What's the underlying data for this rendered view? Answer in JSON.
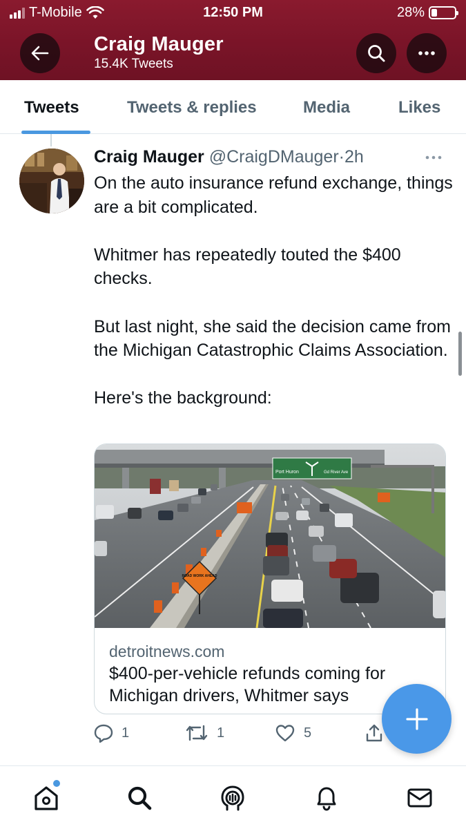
{
  "status_bar": {
    "carrier": "T-Mobile",
    "time": "12:50 PM",
    "battery": "28%"
  },
  "header": {
    "title": "Craig Mauger",
    "subtitle": "15.4K Tweets"
  },
  "tabs": [
    {
      "label": "Tweets",
      "active": true
    },
    {
      "label": "Tweets & replies",
      "active": false
    },
    {
      "label": "Media",
      "active": false
    },
    {
      "label": "Likes",
      "active": false
    }
  ],
  "tweet": {
    "author_name": "Craig Mauger",
    "handle": "@CraigDMauger",
    "separator": "·",
    "time": "2h",
    "paragraphs": [
      "On the auto insurance refund exchange, things are a bit complicated.",
      "Whitmer has repeatedly touted the $400 checks.",
      "But last night, she said the decision came from the Michigan Catastrophic Claims Association.",
      "Here's the background:"
    ],
    "card": {
      "domain": "detroitnews.com",
      "title": "$400-per-vehicle refunds coming for Michigan drivers, Whitmer says",
      "image": {
        "sign_text": "Port Huron",
        "sign_text_2": "Gd River Ave",
        "road_sign_text": "ROAD WORK AHEAD"
      }
    },
    "actions": {
      "replies": "1",
      "retweets": "1",
      "likes": "5"
    }
  },
  "bottom_nav": {
    "items": [
      "home-icon",
      "search-icon",
      "spaces-icon",
      "notifications-icon",
      "messages-icon"
    ],
    "accent": "#4a98e0"
  },
  "colors": {
    "header_bg": "#7a1428",
    "accent": "#4a98e0",
    "secondary_text": "#536471"
  }
}
